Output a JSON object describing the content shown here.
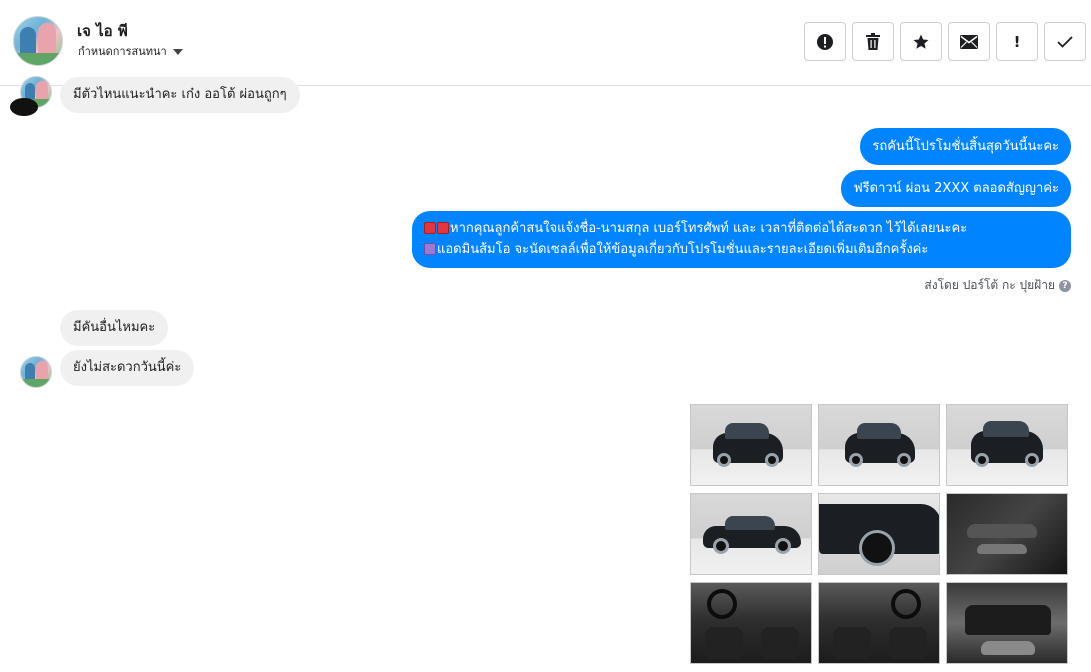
{
  "header": {
    "contact_name": "เจ ไอ พี",
    "subtitle": "กำหนดการสนทนา",
    "actions": [
      {
        "name": "report-button",
        "icon": "alert-circle-icon"
      },
      {
        "name": "delete-button",
        "icon": "trash-icon"
      },
      {
        "name": "star-button",
        "icon": "star-icon"
      },
      {
        "name": "mark-unread-button",
        "icon": "envelope-icon"
      },
      {
        "name": "spam-button",
        "icon": "exclamation-icon",
        "label": "!"
      },
      {
        "name": "mark-done-button",
        "icon": "check-icon"
      }
    ]
  },
  "messages": {
    "m1": "มีตัวไหนแนะนำคะ เก๋ง ออโต้ ผ่อนถูกๆ",
    "m2": "รถคันนี้โปรโมชั่นสิ้นสุดวันนี้นะคะ",
    "m3": "ฟรีดาวน์ ผ่อน 2XXX ตลอดสัญญาค่ะ",
    "m4_line1": "หากคุณลูกค้าสนใจแจ้งชื่อ-นามสกุล เบอร์โทรศัพท์ และ เวลาที่ติดต่อได้สะดวก ไว้ได้เลยนะคะ",
    "m4_line2": "แอดมินส้มโอ จะนัดเซลล์เพื่อให้ข้อมูลเกี่ยวกับโปรโมชั่นและรายละเอียดเพิ่มเติมอีกครั้งค่ะ",
    "sent_by": "ส่งโดย ปอร์โต้ กะ ปุยฝ้าย",
    "m5": "มีคันอื่นไหมคะ",
    "m6": "ยังไม่สะดวกวันนี้ค่ะ"
  },
  "colors": {
    "outgoing_bubble": "#0084ff",
    "incoming_bubble": "#f0f0f0"
  }
}
